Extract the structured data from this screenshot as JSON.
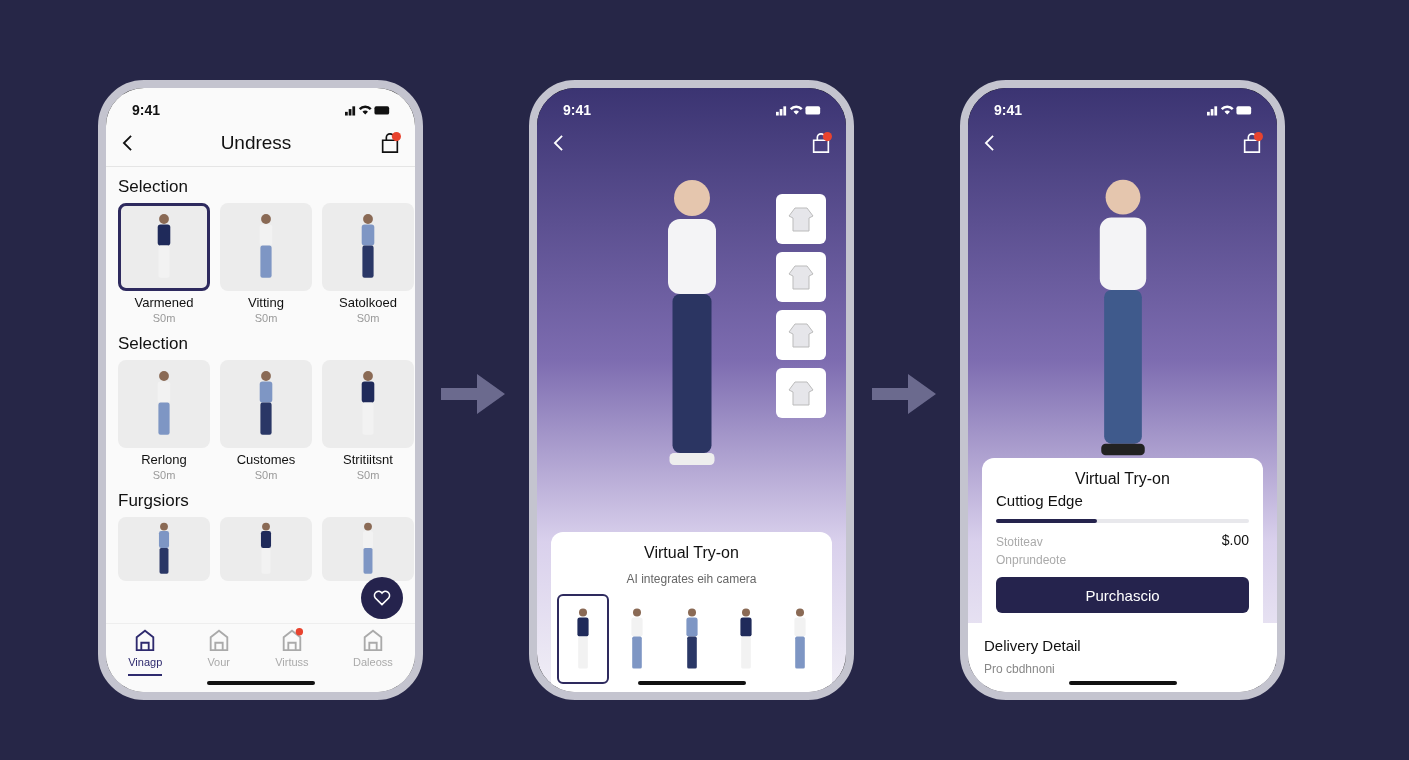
{
  "phones": [
    {
      "kind": "catalog",
      "time": "9:41",
      "title": "Undress",
      "cart_badge": true,
      "sections": [
        {
          "title": "Selection",
          "items": [
            {
              "name": "Varmened",
              "price": "S0m",
              "selected": true
            },
            {
              "name": "Vitting",
              "price": "S0m",
              "selected": false
            },
            {
              "name": "Satolkoed",
              "price": "S0m",
              "selected": false
            }
          ]
        },
        {
          "title": "Selection",
          "items": [
            {
              "name": "Rerlong",
              "price": "S0m",
              "selected": false
            },
            {
              "name": "Customes",
              "price": "S0m",
              "selected": false
            },
            {
              "name": "Stritiitsnt",
              "price": "S0m",
              "selected": false
            }
          ]
        },
        {
          "title": "Furgsiors",
          "items": [
            {
              "selected": false
            },
            {
              "selected": false
            },
            {
              "selected": false
            }
          ]
        }
      ],
      "tabs": [
        {
          "label": "Vinagp",
          "selected": true,
          "badge": false
        },
        {
          "label": "Vour",
          "selected": false,
          "badge": false
        },
        {
          "label": "Virtuss",
          "selected": false,
          "badge": true
        },
        {
          "label": "Daleoss",
          "selected": false,
          "badge": false
        }
      ]
    },
    {
      "kind": "tryon",
      "time": "9:41",
      "cart_badge": true,
      "card": {
        "title": "Virtual Try-on",
        "subtitle": "AI integrates eih camera"
      },
      "avatars": [
        {
          "selected": true
        },
        {
          "selected": false
        },
        {
          "selected": false
        },
        {
          "selected": false
        },
        {
          "selected": false
        }
      ]
    },
    {
      "kind": "checkout",
      "time": "9:41",
      "cart_badge": true,
      "card": {
        "title": "Virtual Try-on",
        "slider_label": "Cuttiog Edge",
        "level": 0.4,
        "line_1": "Stotiteav",
        "price": "$.00",
        "line_2": "Onprundeote",
        "button": "Purchascio"
      },
      "delivery": {
        "title": "Delivery Detail",
        "text": "Pro cbdhnoni"
      }
    }
  ]
}
